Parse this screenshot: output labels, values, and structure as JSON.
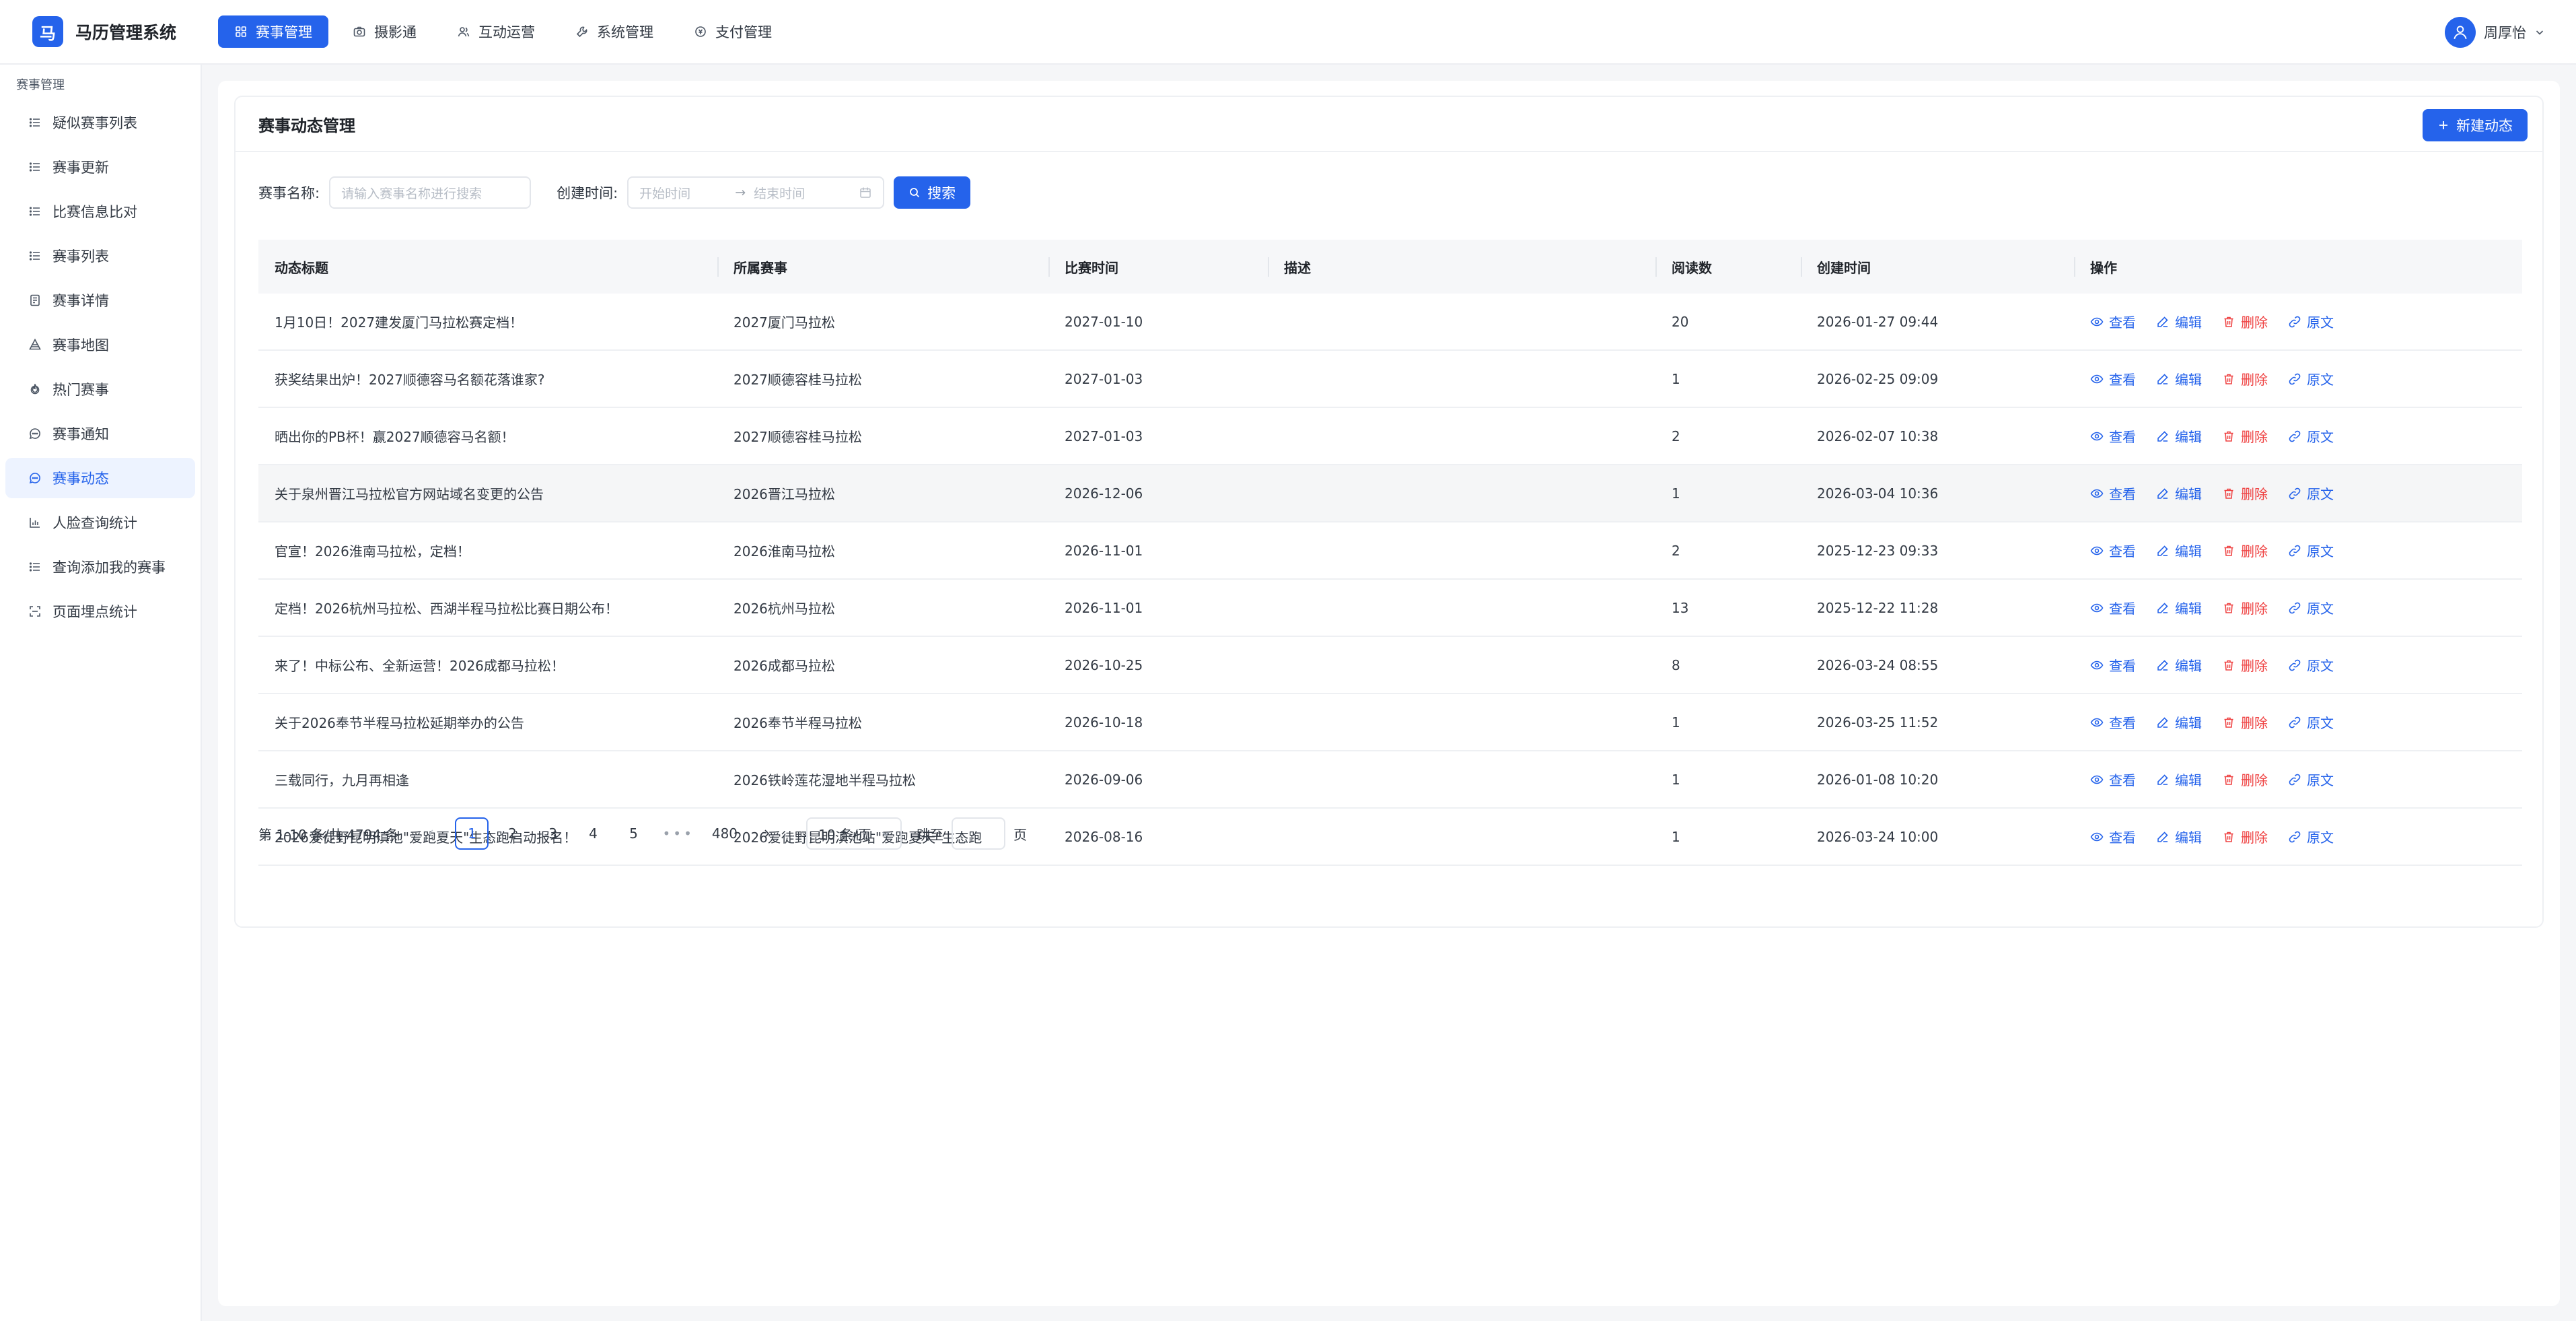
{
  "app": {
    "logo_char": "马",
    "title": "马历管理系统"
  },
  "topnav": [
    {
      "label": "赛事管理",
      "icon": "grid-icon",
      "active": true
    },
    {
      "label": "摄影通",
      "icon": "camera-icon",
      "active": false
    },
    {
      "label": "互动运营",
      "icon": "users-icon",
      "active": false
    },
    {
      "label": "系统管理",
      "icon": "wrench-icon",
      "active": false
    },
    {
      "label": "支付管理",
      "icon": "payment-icon",
      "active": false
    }
  ],
  "user": {
    "name": "周厚怡"
  },
  "sidebar": {
    "group_label": "赛事管理",
    "items": [
      {
        "label": "疑似赛事列表",
        "icon": "list-icon"
      },
      {
        "label": "赛事更新",
        "icon": "list-icon"
      },
      {
        "label": "比赛信息比对",
        "icon": "list-icon"
      },
      {
        "label": "赛事列表",
        "icon": "list-icon"
      },
      {
        "label": "赛事详情",
        "icon": "detail-icon"
      },
      {
        "label": "赛事地图",
        "icon": "map-icon"
      },
      {
        "label": "热门赛事",
        "icon": "fire-icon"
      },
      {
        "label": "赛事通知",
        "icon": "message-icon"
      },
      {
        "label": "赛事动态",
        "icon": "message-icon",
        "active": true
      },
      {
        "label": "人脸查询统计",
        "icon": "chart-icon"
      },
      {
        "label": "查询添加我的赛事",
        "icon": "list-icon"
      },
      {
        "label": "页面埋点统计",
        "icon": "scan-icon"
      }
    ]
  },
  "page": {
    "title": "赛事动态管理",
    "new_button": "新建动态"
  },
  "filters": {
    "name_label": "赛事名称:",
    "name_placeholder": "请输入赛事名称进行搜索",
    "time_label": "创建时间:",
    "start_placeholder": "开始时间",
    "range_arrow": "→",
    "end_placeholder": "结束时间",
    "search_button": "搜索"
  },
  "table": {
    "columns": [
      "动态标题",
      "所属赛事",
      "比赛时间",
      "描述",
      "阅读数",
      "创建时间",
      "操作"
    ],
    "action_labels": {
      "view": "查看",
      "edit": "编辑",
      "delete": "删除",
      "source": "原文"
    },
    "rows": [
      {
        "title": "1月10日！2027建发厦门马拉松赛定档！",
        "event": "2027厦门马拉松",
        "date": "2027-01-10",
        "desc": "",
        "reads": "20",
        "created": "2026-01-27 09:44"
      },
      {
        "title": "获奖结果出炉！2027顺德容马名额花落谁家?",
        "event": "2027顺德容桂马拉松",
        "date": "2027-01-03",
        "desc": "",
        "reads": "1",
        "created": "2026-02-25 09:09"
      },
      {
        "title": "晒出你的PB杯！赢2027顺德容马名额！",
        "event": "2027顺德容桂马拉松",
        "date": "2027-01-03",
        "desc": "",
        "reads": "2",
        "created": "2026-02-07 10:38"
      },
      {
        "title": "关于泉州晋江马拉松官方网站域名变更的公告",
        "event": "2026晋江马拉松",
        "date": "2026-12-06",
        "desc": "",
        "reads": "1",
        "created": "2026-03-04 10:36"
      },
      {
        "title": "官宣！2026淮南马拉松，定档！",
        "event": "2026淮南马拉松",
        "date": "2026-11-01",
        "desc": "",
        "reads": "2",
        "created": "2025-12-23 09:33"
      },
      {
        "title": "定档！2026杭州马拉松、西湖半程马拉松比赛日期公布！",
        "event": "2026杭州马拉松",
        "date": "2026-11-01",
        "desc": "",
        "reads": "13",
        "created": "2025-12-22 11:28"
      },
      {
        "title": "来了！中标公布、全新运营！2026成都马拉松！",
        "event": "2026成都马拉松",
        "date": "2026-10-25",
        "desc": "",
        "reads": "8",
        "created": "2026-03-24 08:55"
      },
      {
        "title": "关于2026奉节半程马拉松延期举办的公告",
        "event": "2026奉节半程马拉松",
        "date": "2026-10-18",
        "desc": "",
        "reads": "1",
        "created": "2026-03-25 11:52"
      },
      {
        "title": "三载同行，九月再相逢",
        "event": "2026铁岭莲花湿地半程马拉松",
        "date": "2026-09-06",
        "desc": "",
        "reads": "1",
        "created": "2026-01-08 10:20"
      },
      {
        "title": "2026爱徒野昆明滇池\"爱跑夏天\"生态跑启动报名！",
        "event": "2026爱徒野昆明滇池站\"爱跑夏天\"生态跑",
        "date": "2026-08-16",
        "desc": "",
        "reads": "1",
        "created": "2026-03-24 10:00"
      }
    ]
  },
  "pagination": {
    "total_text": "第 1-10 条/共 4794 条",
    "pages": [
      "1",
      "2",
      "3",
      "4",
      "5"
    ],
    "ellipsis": "•••",
    "last_page": "480",
    "current_page": "1",
    "page_size": "10 条/页",
    "jump_label": "跳至",
    "jump_suffix": "页"
  },
  "colors": {
    "primary": "#2563eb",
    "danger": "#ef4444",
    "active_bg": "#edf3ff"
  }
}
